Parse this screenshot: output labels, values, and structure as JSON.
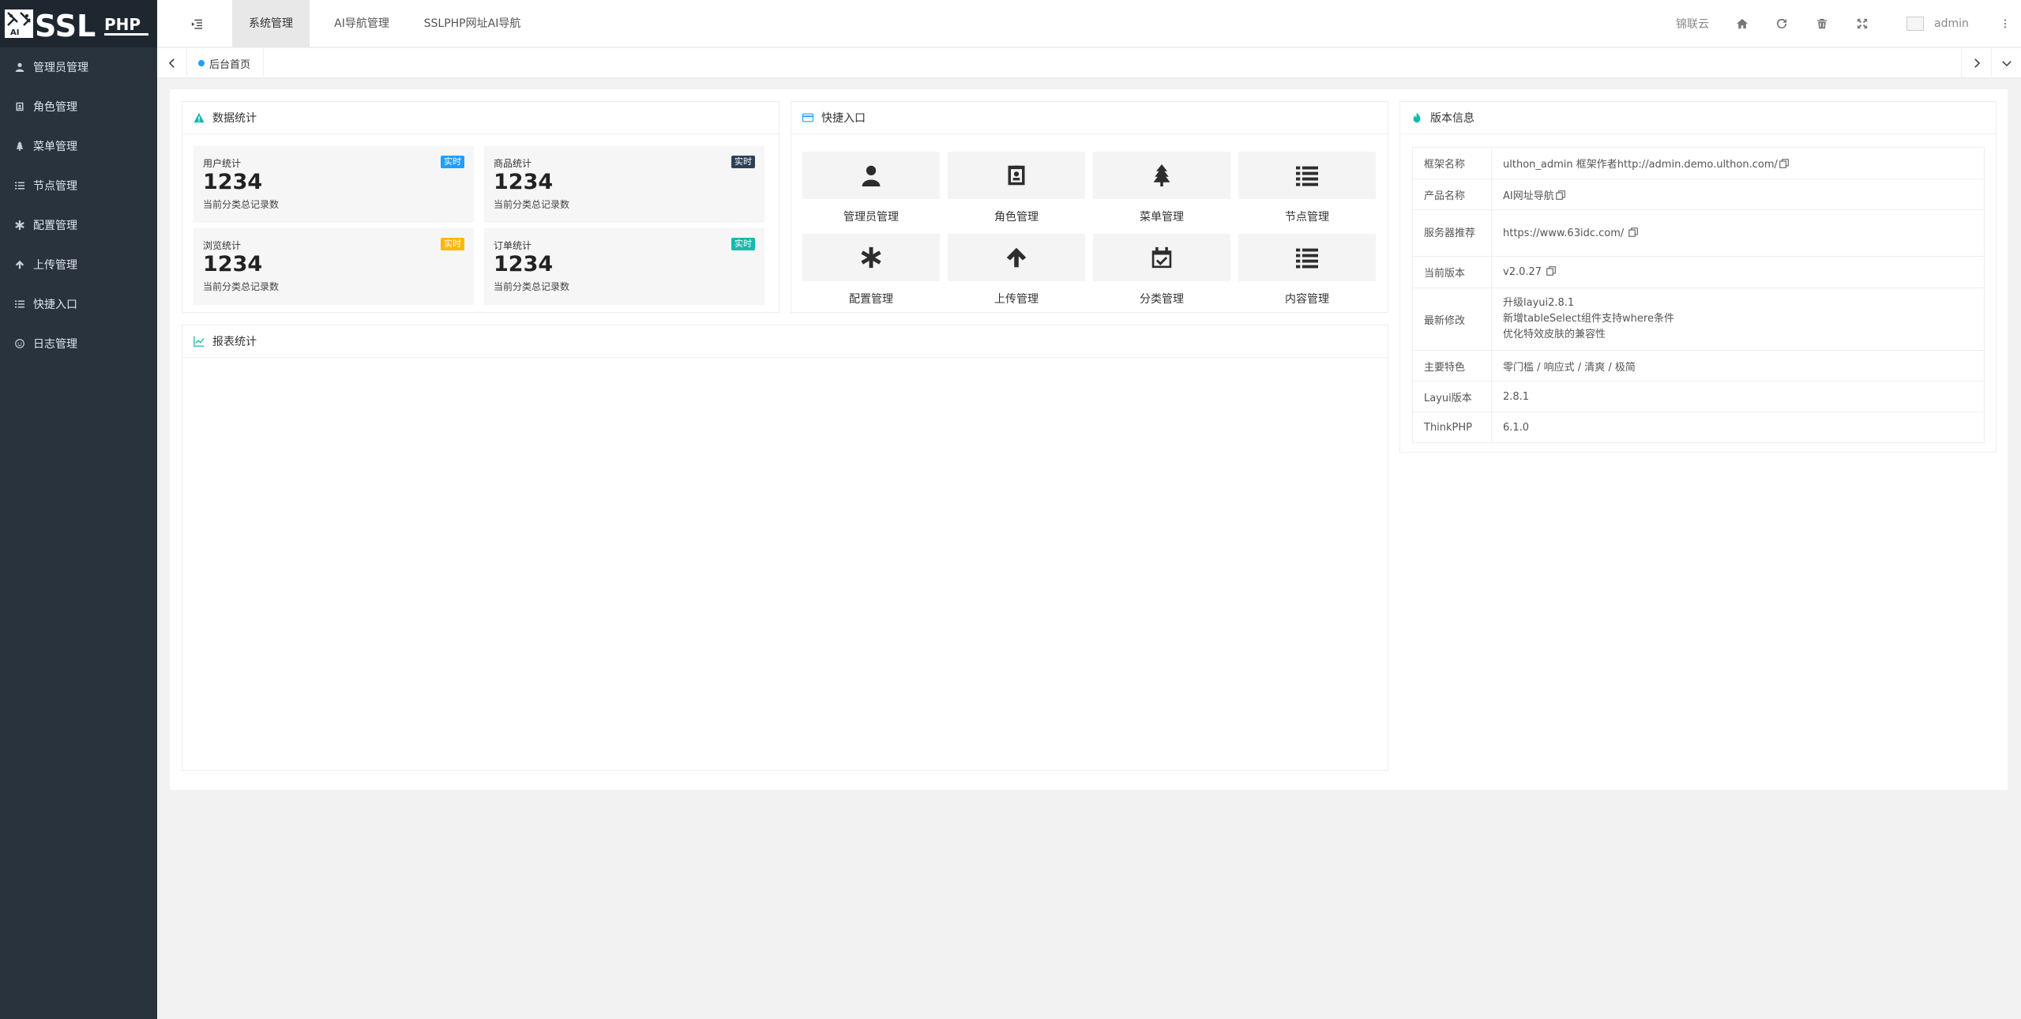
{
  "sidebar": {
    "items": [
      {
        "label": "管理员管理",
        "icon": "user-icon"
      },
      {
        "label": "角色管理",
        "icon": "id-card-icon"
      },
      {
        "label": "菜单管理",
        "icon": "tree-icon"
      },
      {
        "label": "节点管理",
        "icon": "list-icon"
      },
      {
        "label": "配置管理",
        "icon": "asterisk-icon"
      },
      {
        "label": "上传管理",
        "icon": "arrow-up-icon"
      },
      {
        "label": "快捷入口",
        "icon": "list-icon"
      },
      {
        "label": "日志管理",
        "icon": "log-icon"
      }
    ]
  },
  "logo": {
    "text_big": "SSL",
    "text_small": "PHP",
    "mark": "AI"
  },
  "header": {
    "tabs": [
      {
        "label": "系统管理",
        "active": true
      },
      {
        "label": "AI导航管理",
        "active": false
      },
      {
        "label": "SSLPHP网址AI导航",
        "active": false
      }
    ],
    "link_text": "锦联云",
    "user_name": "admin"
  },
  "tabbar": {
    "home_label": "后台首页"
  },
  "stats_card": {
    "title": "数据统计",
    "items": [
      {
        "title": "用户统计",
        "badge": "实时",
        "badge_color": "#1e9fff",
        "value": "1234",
        "desc": "当前分类总记录数"
      },
      {
        "title": "商品统计",
        "badge": "实时",
        "badge_color": "#2f4056",
        "value": "1234",
        "desc": "当前分类总记录数"
      },
      {
        "title": "浏览统计",
        "badge": "实时",
        "badge_color": "#ffb800",
        "value": "1234",
        "desc": "当前分类总记录数"
      },
      {
        "title": "订单统计",
        "badge": "实时",
        "badge_color": "#16baaa",
        "value": "1234",
        "desc": "当前分类总记录数"
      }
    ]
  },
  "quick_card": {
    "title": "快捷入口",
    "items": [
      {
        "label": "管理员管理",
        "icon": "user-icon"
      },
      {
        "label": "角色管理",
        "icon": "id-card-icon"
      },
      {
        "label": "菜单管理",
        "icon": "tree-icon"
      },
      {
        "label": "节点管理",
        "icon": "list-icon"
      },
      {
        "label": "配置管理",
        "icon": "asterisk-icon"
      },
      {
        "label": "上传管理",
        "icon": "arrow-up-icon"
      },
      {
        "label": "分类管理",
        "icon": "calendar-check-icon"
      },
      {
        "label": "内容管理",
        "icon": "list-icon"
      }
    ]
  },
  "report_card": {
    "title": "报表统计"
  },
  "version_card": {
    "title": "版本信息",
    "rows": [
      {
        "key": "框架名称",
        "value": "ulthon_admin 框架作者http://admin.demo.ulthon.com/"
      },
      {
        "key": "产品名称",
        "value": "AI网址导航"
      },
      {
        "key": "服务器推荐",
        "value": "https://www.63idc.com/ "
      },
      {
        "key": "当前版本",
        "value": "v2.0.27 "
      },
      {
        "key": "最新修改",
        "lines": [
          "升级layui2.8.1",
          "新增tableSelect组件支持where条件",
          "优化特效皮肤的兼容性"
        ]
      },
      {
        "key": "主要特色",
        "value": "零门槛 / 响应式 / 清爽 / 极简"
      },
      {
        "key": "Layui版本",
        "value": "2.8.1"
      },
      {
        "key": "ThinkPHP",
        "value": "6.1.0"
      }
    ]
  },
  "colors": {
    "sidebar_bg": "#28333e",
    "logo_bg": "#1e2730",
    "accent_blue": "#1e9fff",
    "accent_green": "#16baaa",
    "accent_orange": "#ffb800",
    "accent_dark": "#2f4056"
  }
}
